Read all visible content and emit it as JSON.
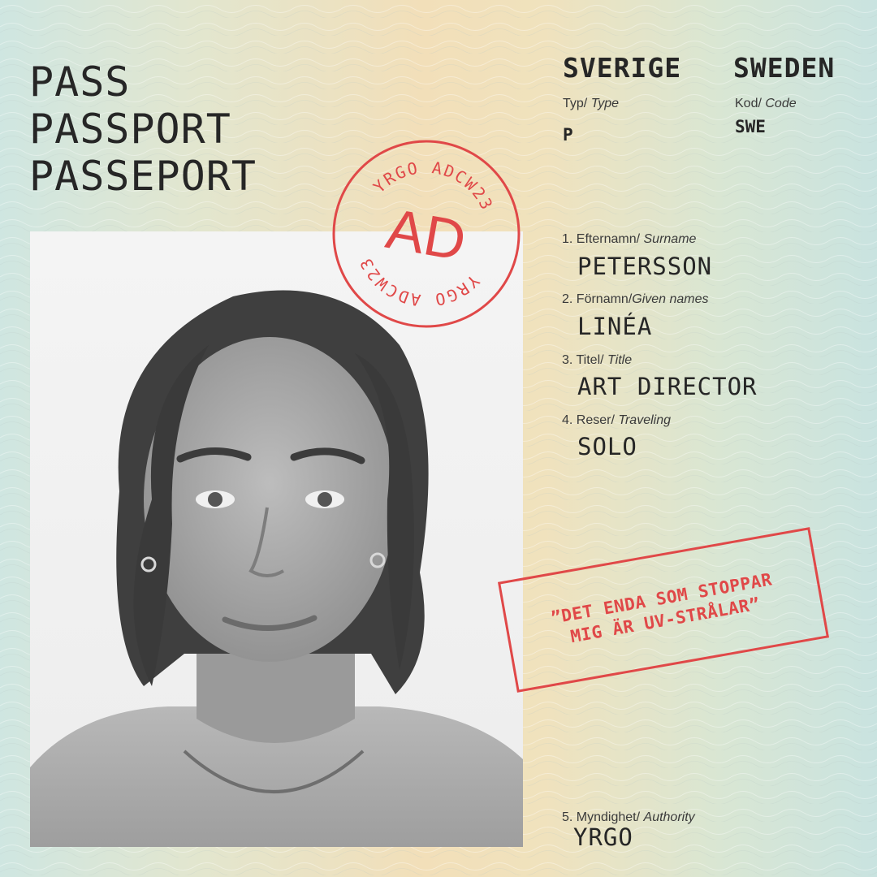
{
  "document": {
    "title_lines": [
      "PASS",
      "PASSPORT",
      "PASSEPORT"
    ],
    "country_native": "SVERIGE",
    "country_english": "SWEDEN"
  },
  "type_field": {
    "label": "Typ/",
    "label_en": "Type",
    "value": "P"
  },
  "code_field": {
    "label": "Kod/",
    "label_en": "Code",
    "value": "SWE"
  },
  "fields": [
    {
      "label": "1. Efternamn/",
      "label_en": "Surname",
      "value": "PETERSSON"
    },
    {
      "label": "2. Förnamn/",
      "label_en": "Given names",
      "value": "LINÉA"
    },
    {
      "label": "3. Titel/",
      "label_en": "Title",
      "value": "ART DIRECTOR"
    },
    {
      "label": "4. Reser/",
      "label_en": "Traveling",
      "value": "SOLO"
    },
    {
      "label": "5. Myndighet/",
      "label_en": "Authority",
      "value": "YRGO"
    }
  ],
  "round_stamp": {
    "top_text": "YRGO ADCW23",
    "bottom_text": "YRGO ADCW23",
    "center": "AD"
  },
  "quote_stamp": {
    "line1": "”DET ENDA SOM STOPPAR",
    "line2": "MIG ÄR UV-STRÅLAR”"
  },
  "colors": {
    "stamp": "#e04848",
    "ink": "#262626"
  },
  "photo": {
    "description_icon": "portrait-photo"
  }
}
